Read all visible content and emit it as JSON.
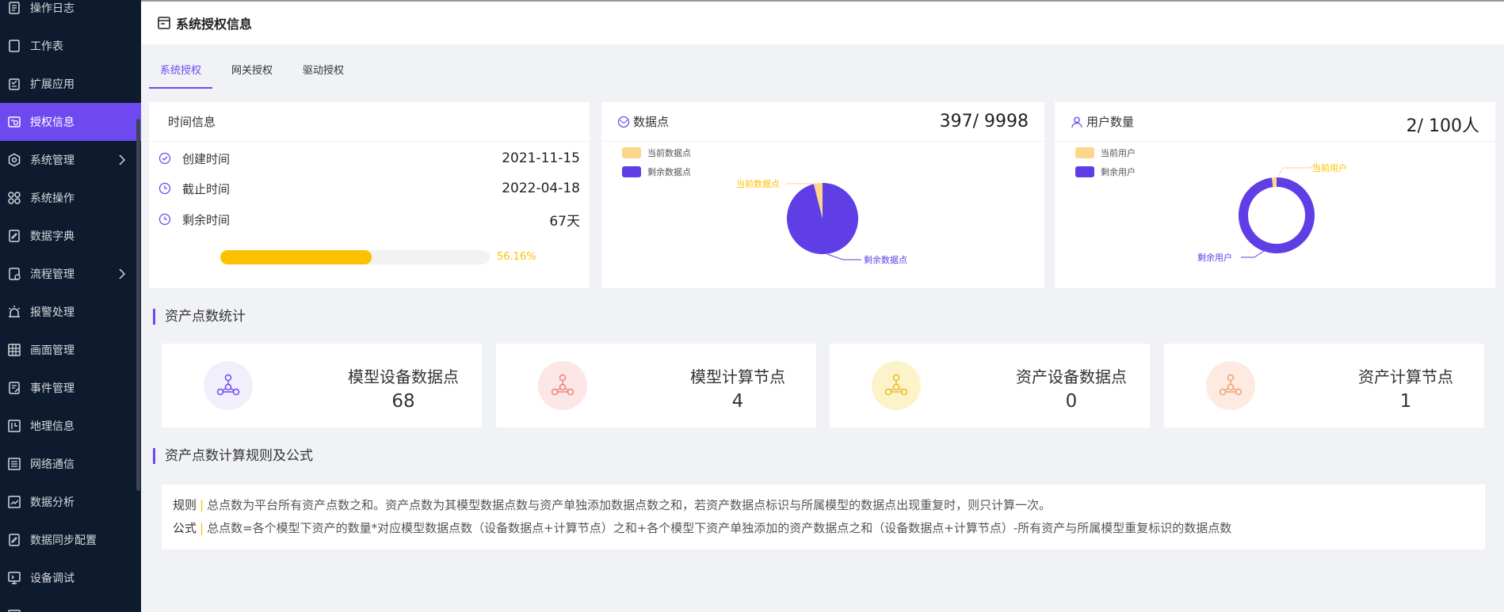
{
  "sidebar": {
    "items": [
      {
        "label": "操作日志",
        "icon": "log-icon"
      },
      {
        "label": "工作表",
        "icon": "worksheet-icon"
      },
      {
        "label": "扩展应用",
        "icon": "extension-icon"
      },
      {
        "label": "授权信息",
        "icon": "license-icon",
        "active": true
      },
      {
        "label": "系统管理",
        "icon": "gear-icon",
        "has_children": true
      },
      {
        "label": "系统操作",
        "icon": "grid-icon"
      },
      {
        "label": "数据字典",
        "icon": "dictionary-icon"
      },
      {
        "label": "流程管理",
        "icon": "flow-icon",
        "has_children": true
      },
      {
        "label": "报警处理",
        "icon": "alarm-icon"
      },
      {
        "label": "画面管理",
        "icon": "screen-icon"
      },
      {
        "label": "事件管理",
        "icon": "event-icon"
      },
      {
        "label": "地理信息",
        "icon": "map-icon"
      },
      {
        "label": "网络通信",
        "icon": "network-icon"
      },
      {
        "label": "数据分析",
        "icon": "analysis-icon"
      },
      {
        "label": "数据同步配置",
        "icon": "sync-icon"
      },
      {
        "label": "设备调试",
        "icon": "debug-icon"
      },
      {
        "label": "",
        "icon": "more-icon"
      }
    ]
  },
  "header": {
    "title": "系统授权信息"
  },
  "tabs": [
    {
      "label": "系统授权",
      "active": true
    },
    {
      "label": "网关授权"
    },
    {
      "label": "驱动授权"
    }
  ],
  "time_card": {
    "title": "时间信息",
    "rows": [
      {
        "label": "创建时间",
        "value": "2021-11-15"
      },
      {
        "label": "截止时间",
        "value": "2022-04-18"
      },
      {
        "label": "剩余时间",
        "value": "67天"
      }
    ],
    "progress": 0.5616,
    "progress_text": "56.16%"
  },
  "datapoint_card": {
    "title": "数据点",
    "total_text": "397/ 9998",
    "legend": [
      "当前数据点",
      "剩余数据点"
    ],
    "chart_labels": {
      "current": "当前数据点",
      "remaining": "剩余数据点"
    }
  },
  "user_card": {
    "title": "用户数量",
    "total_text": "2/ 100人",
    "legend": [
      "当前用户",
      "剩余用户"
    ],
    "chart_labels": {
      "current": "当前用户",
      "remaining": "剩余用户"
    }
  },
  "colors": {
    "accent": "#6f49f0",
    "current": "#fcd68a",
    "remaining": "#5f3ee6",
    "progress": "#fcc100"
  },
  "chart_data": [
    {
      "type": "pie",
      "categories": [
        "当前数据点",
        "剩余数据点"
      ],
      "values": [
        397,
        9601
      ]
    },
    {
      "type": "pie",
      "categories": [
        "当前用户",
        "剩余用户"
      ],
      "values": [
        2,
        98
      ],
      "donut": true
    }
  ],
  "asset_section": {
    "title": "资产点数统计"
  },
  "asset_stats": [
    {
      "label": "模型设备数据点",
      "value": "68",
      "icon_color": "#6f49f0",
      "bg": "#f2effd"
    },
    {
      "label": "模型计算节点",
      "value": "4",
      "icon_color": "#f08080",
      "bg": "#fde6e6"
    },
    {
      "label": "资产设备数据点",
      "value": "0",
      "icon_color": "#e8b92e",
      "bg": "#fdf3c9"
    },
    {
      "label": "资产计算节点",
      "value": "1",
      "icon_color": "#f0a070",
      "bg": "#fdebe2"
    }
  ],
  "rules_section": {
    "title": "资产点数计算规则及公式"
  },
  "rules": {
    "rule_key": "规则",
    "rule_text": "总点数为平台所有资产点数之和。资产点数为其模型数据点数与资产单独添加数据点数之和，若资产数据点标识与所属模型的数据点出现重复时，则只计算一次。",
    "formula_key": "公式",
    "formula_text": "总点数=各个模型下资产的数量*对应模型数据点数（设备数据点+计算节点）之和+各个模型下资产单独添加的资产数据点之和（设备数据点+计算节点）-所有资产与所属模型重复标识的数据点数"
  }
}
